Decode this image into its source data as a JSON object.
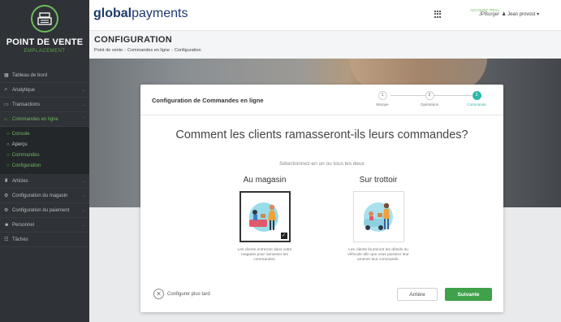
{
  "sidebar": {
    "logo_title": "POINT DE VENTE",
    "logo_sub": "EMPLACEMENT",
    "items": [
      {
        "label": "Tableau de bord",
        "icon": "dashboard-icon"
      },
      {
        "label": "Analytique",
        "icon": "analytics-icon"
      },
      {
        "label": "Transactions",
        "icon": "transactions-icon"
      },
      {
        "label": "Commandes en ligne",
        "icon": "basket-icon"
      }
    ],
    "subitems": [
      "Console",
      "Aperçu",
      "Commandes",
      "Configuration"
    ],
    "items_after": [
      {
        "label": "Articles",
        "icon": "articles-icon"
      },
      {
        "label": "Configuration du magasin",
        "icon": "store-settings-icon"
      },
      {
        "label": "Configuration du paiement",
        "icon": "payment-settings-icon"
      },
      {
        "label": "Personnel",
        "icon": "staff-icon"
      },
      {
        "label": "Tâches",
        "icon": "tasks-icon"
      }
    ]
  },
  "topbar": {
    "brand_bold": "global",
    "brand_light": "payments",
    "account_label": "ACCOUNT TRIAL",
    "account_name": "JPBurger",
    "user_name": "Jean provost"
  },
  "header": {
    "title": "CONFIGURATION",
    "breadcrumb": [
      "Point de vente",
      "Commandes en ligne",
      "Configuration"
    ]
  },
  "modal": {
    "title": "Configuration de Commandes en ligne",
    "steps": [
      {
        "num": "1",
        "label": "Marque"
      },
      {
        "num": "2",
        "label": "Opérations"
      },
      {
        "num": "3",
        "label": "Commande"
      }
    ],
    "question": "Comment les clients ramasseront-ils leurs commandes?",
    "hint": "Sélectionnez-en un ou tous les deux",
    "options": [
      {
        "title": "Au magasin",
        "desc": "Les clients entreront dans votre magasin pour ramasser les commandes.",
        "selected": true
      },
      {
        "title": "Sur trottoir",
        "desc": "Les clients fourniront les détails du véhicule afin que vous puissiez leur amener leur commande.",
        "selected": false
      }
    ],
    "later_label": "Configurer plus tard",
    "back_label": "Arrière",
    "next_label": "Suivante"
  },
  "colors": {
    "sidebar_bg": "#2f3236",
    "accent_green": "#6dbb5e",
    "step_active": "#2fb8a6",
    "next_button": "#3fa14a"
  }
}
